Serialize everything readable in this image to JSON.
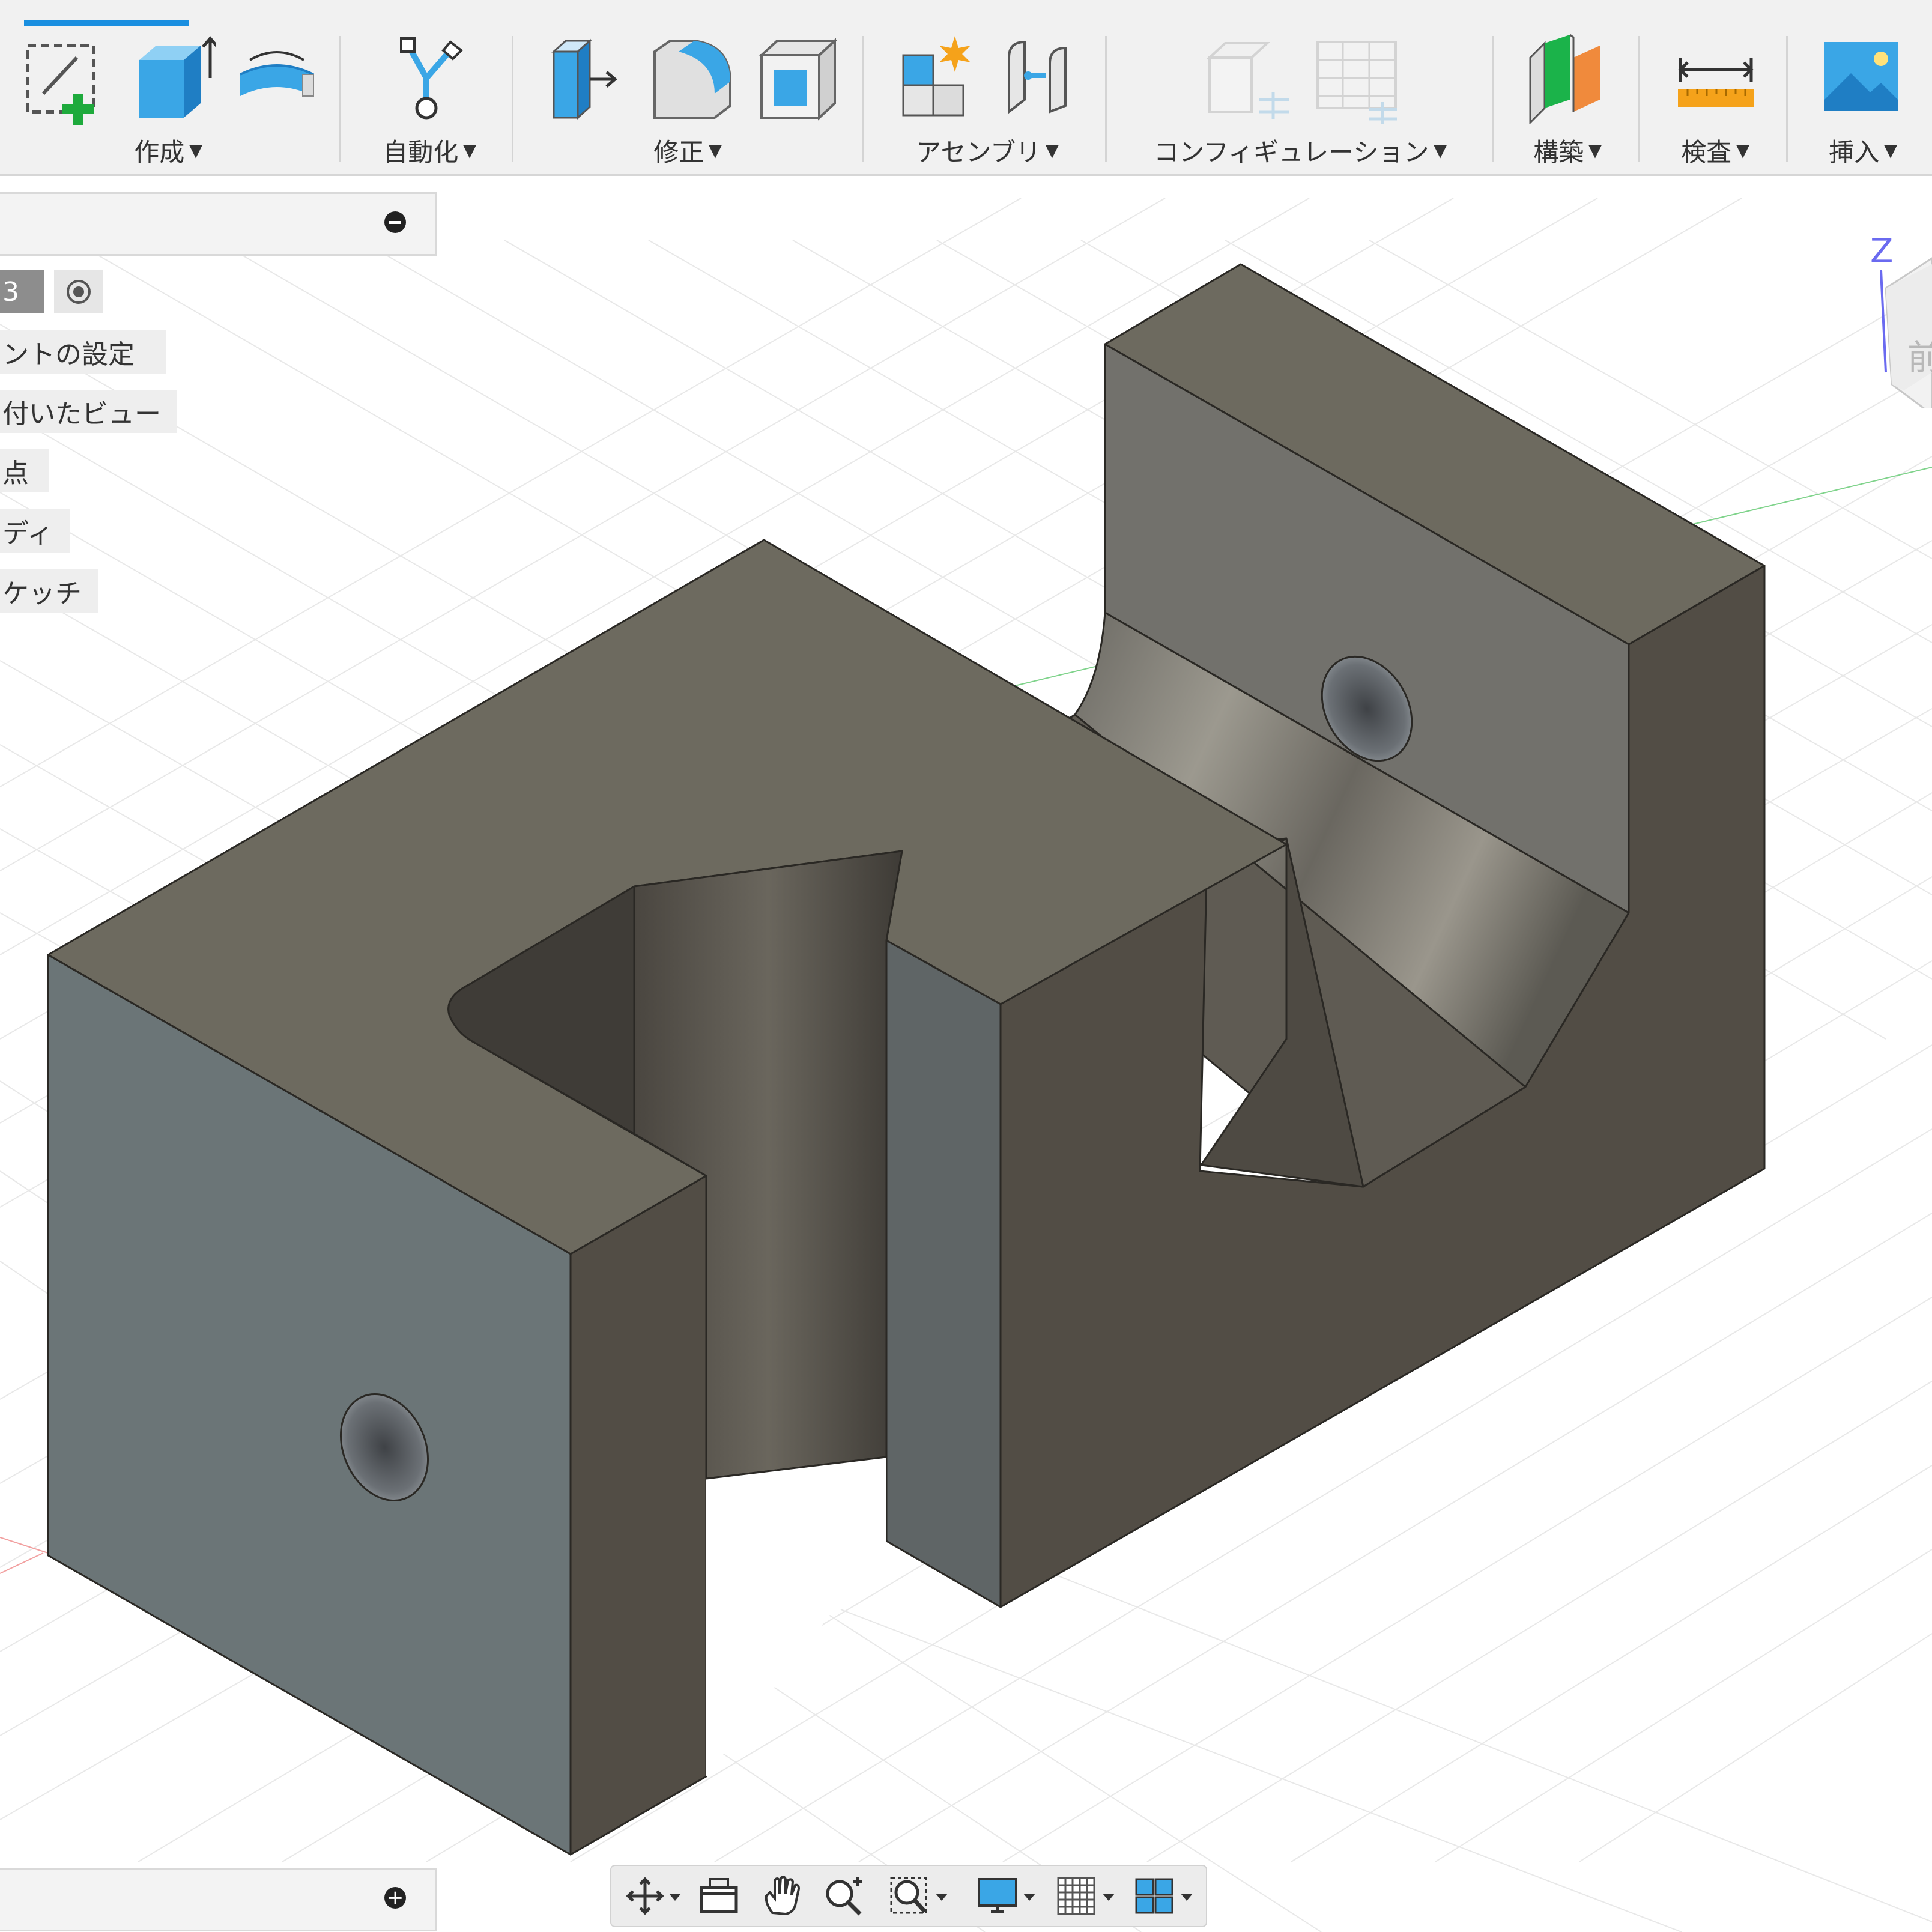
{
  "toolbar": {
    "active_tab_underline_color": "#1a8fe0",
    "groups": [
      {
        "label": "作成",
        "icons": [
          "new-sketch-icon",
          "extrude-icon",
          "revolve-icon"
        ]
      },
      {
        "label": "自動化",
        "icons": [
          "automate-icon"
        ]
      },
      {
        "label": "修正",
        "icons": [
          "press-pull-icon",
          "fillet-icon",
          "shell-icon"
        ]
      },
      {
        "label": "アセンブリ",
        "icons": [
          "new-component-icon",
          "joint-icon"
        ]
      },
      {
        "label": "コンフィギュレーション",
        "icons": [
          "configuration-icon",
          "configuration-table-icon"
        ]
      },
      {
        "label": "構築",
        "icons": [
          "construct-plane-icon"
        ]
      },
      {
        "label": "検査",
        "icons": [
          "measure-icon"
        ]
      },
      {
        "label": "挿入",
        "icons": [
          "insert-image-icon"
        ]
      }
    ]
  },
  "browser": {
    "version_badge": "3",
    "items": [
      "ントの設定",
      "付いたビュー",
      "点",
      "ディ",
      "ケッチ"
    ]
  },
  "viewcube": {
    "axis_label": "Z",
    "face_label": "前"
  },
  "navigation_bar": {
    "icons": [
      "orbit-icon",
      "look-at-icon",
      "pan-icon",
      "zoom-icon",
      "fit-icon",
      "display-settings-icon",
      "grid-settings-icon",
      "viewports-icon"
    ]
  },
  "model": {
    "face_colors": {
      "top": "#6d6a5f",
      "left_front": "#6b7577",
      "right_side": "#524d45",
      "inner": "#5b574f",
      "back_face": "#72716c"
    }
  }
}
